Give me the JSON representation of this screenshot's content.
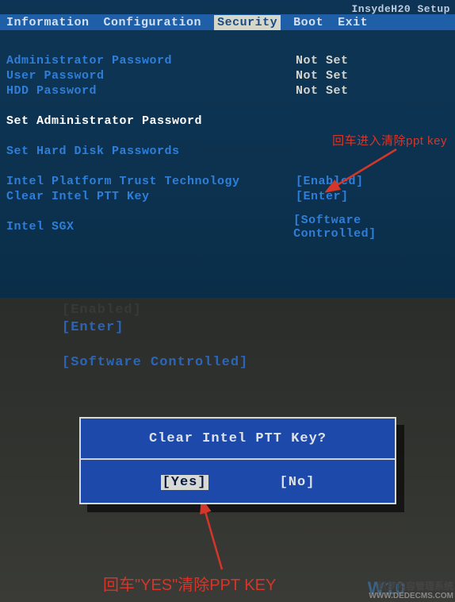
{
  "setup_title": "InsydeH20 Setup",
  "tabs": {
    "information": "Information",
    "configuration": "Configuration",
    "security": "Security",
    "boot": "Boot",
    "exit": "Exit"
  },
  "top": {
    "admin_pw_label": "Administrator Password",
    "admin_pw_value": "Not Set",
    "user_pw_label": "User Password",
    "user_pw_value": "Not Set",
    "hdd_pw_label": "HDD Password",
    "hdd_pw_value": "Not Set",
    "set_admin_pw": "Set Administrator Password",
    "set_hdd_pw": "Set Hard Disk Passwords",
    "iptt_label": "Intel Platform Trust Technology",
    "iptt_value": "[Enabled]",
    "clear_ptt_label": "Clear Intel PTT Key",
    "clear_ptt_value": "[Enter]",
    "sgx_label": "Intel SGX",
    "sgx_value": "[Software Controlled]"
  },
  "annotation_top": "回车进入清除ppt key",
  "bottom": {
    "ghost": "[Enabled]",
    "enter": "[Enter]",
    "sw_ctrl": "[Software Controlled]"
  },
  "dialog": {
    "title": "Clear Intel PTT Key?",
    "yes": "[Yes]",
    "no": "[No]"
  },
  "annotation_bottom": "回车\"YES\"清除PPT KEY",
  "watermark": {
    "w10": "W10",
    "cn": "织梦内容管理系统",
    "url": "WWW.DEDECMS.COM"
  }
}
